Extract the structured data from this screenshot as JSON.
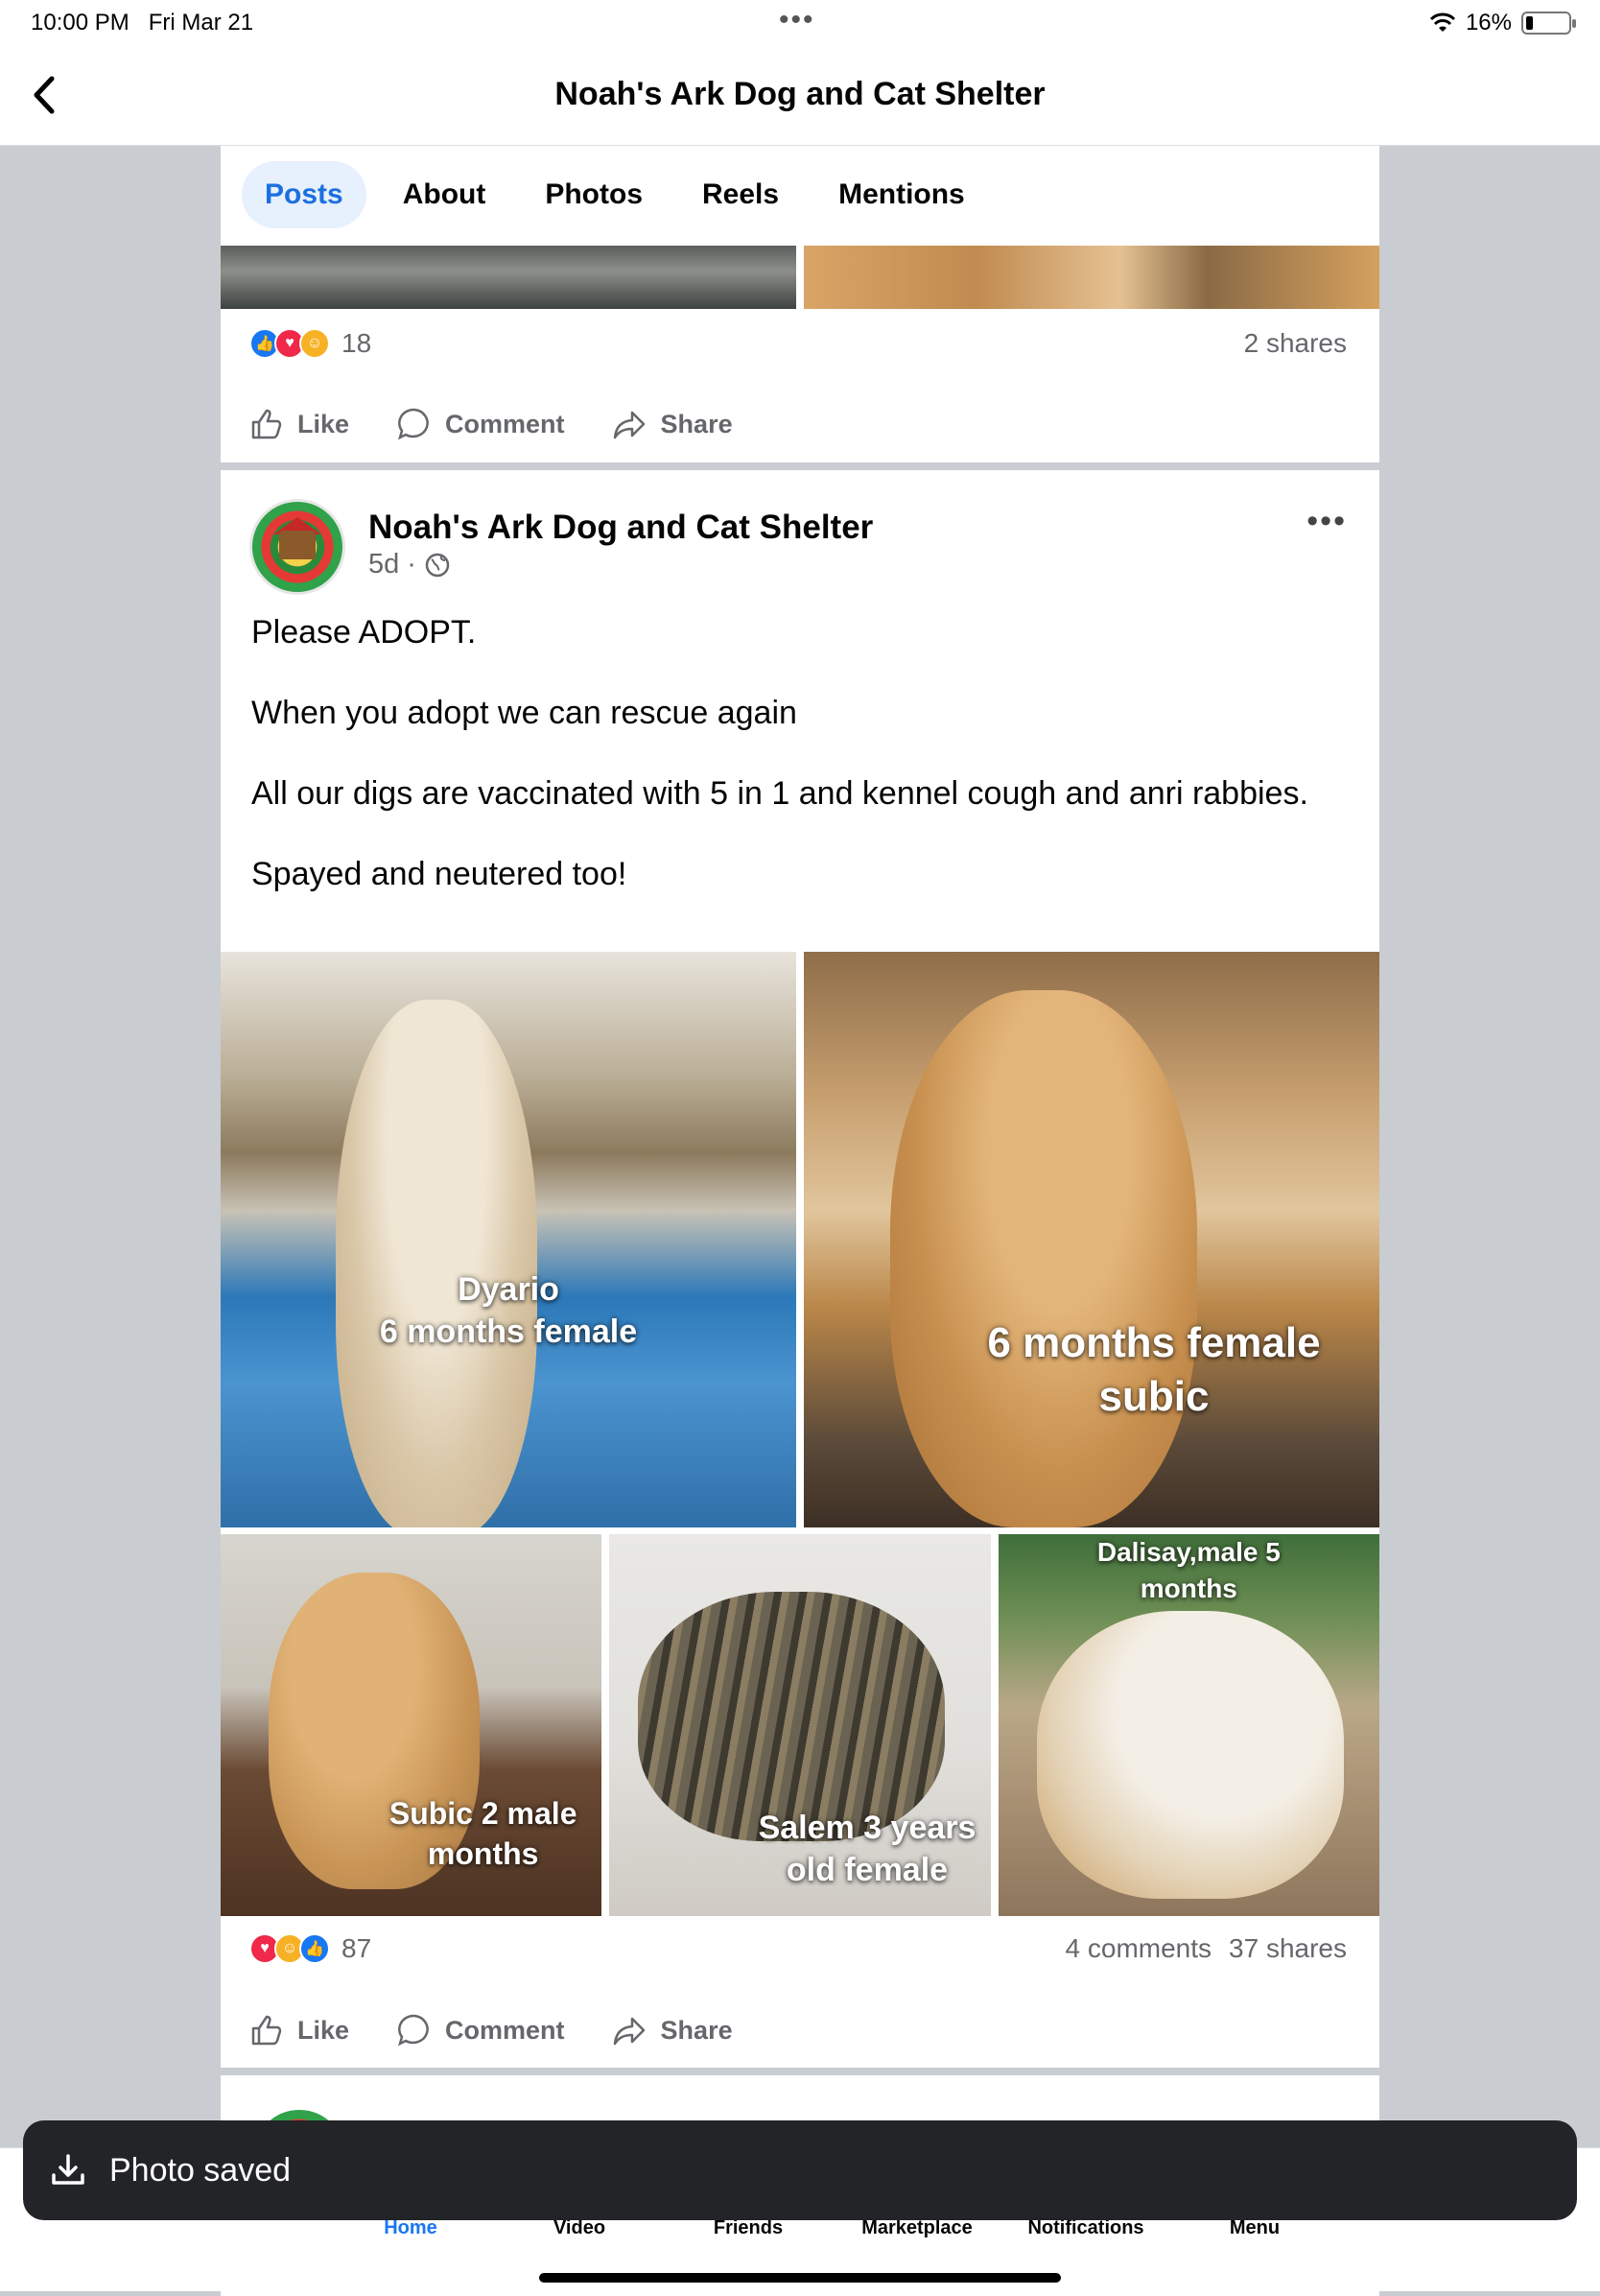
{
  "status_bar": {
    "time": "10:00 PM",
    "date": "Fri Mar 21",
    "battery": "16%",
    "battery_level": 0.16
  },
  "header": {
    "title": "Noah's Ark Dog and Cat Shelter"
  },
  "tabs": [
    {
      "label": "Posts",
      "active": true
    },
    {
      "label": "About",
      "active": false
    },
    {
      "label": "Photos",
      "active": false
    },
    {
      "label": "Reels",
      "active": false
    },
    {
      "label": "Mentions",
      "active": false
    }
  ],
  "prev_post": {
    "reaction_count": "18",
    "shares": "2 shares"
  },
  "actions": {
    "like": "Like",
    "comment": "Comment",
    "share": "Share"
  },
  "post": {
    "author": "Noah's Ark Dog and Cat Shelter",
    "time": "5d",
    "text": {
      "p1": "Please ADOPT.",
      "p2": "When you adopt we can rescue again",
      "p3": "All our digs are vaccinated with 5 in 1 and kennel cough and anri rabbies.",
      "p4": "Spayed and neutered too!"
    },
    "photos": [
      {
        "line1": "Dyario",
        "line2": "6 months female"
      },
      {
        "line1": "6 months female",
        "line2": "subic"
      },
      {
        "line1": "Subic 2 male",
        "line2": "months"
      },
      {
        "line1": "Salem 3 years",
        "line2": "old female"
      },
      {
        "line1": "Dalisay,male 5",
        "line2": "months"
      }
    ],
    "reaction_count": "87",
    "comments": "4 comments",
    "shares": "37 shares"
  },
  "toast": {
    "text": "Photo saved"
  },
  "tab_bar": [
    {
      "label": "Home",
      "active": true
    },
    {
      "label": "Video",
      "active": false
    },
    {
      "label": "Friends",
      "active": false
    },
    {
      "label": "Marketplace",
      "active": false
    },
    {
      "label": "Notifications",
      "active": false
    },
    {
      "label": "Menu",
      "active": false
    }
  ]
}
